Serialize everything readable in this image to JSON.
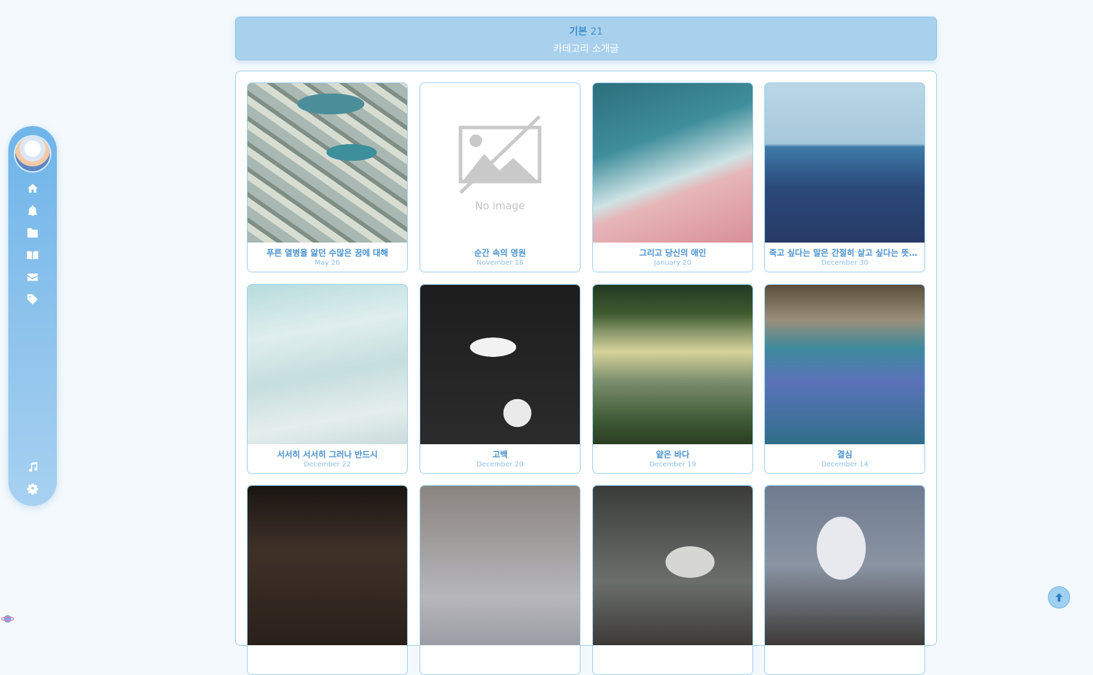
{
  "header": {
    "category_name": "기본",
    "count": "21",
    "description": "카테고리 소개글"
  },
  "sidebar": {
    "items": [
      {
        "icon": "home-icon"
      },
      {
        "icon": "bell-icon"
      },
      {
        "icon": "folder-icon"
      },
      {
        "icon": "book-icon"
      },
      {
        "icon": "envelope-icon"
      },
      {
        "icon": "tag-icon"
      },
      {
        "icon": "music-icon"
      },
      {
        "icon": "gear-icon"
      }
    ]
  },
  "placeholder": {
    "no_image_text": "No image"
  },
  "posts": [
    {
      "title": "푸른 열병을 앓던 수많은 꿈에 대해",
      "date": "May 26"
    },
    {
      "title": "순간 속의 영원",
      "date": "November 16"
    },
    {
      "title": "그리고 당신의 애인",
      "date": "January 20"
    },
    {
      "title": "죽고 싶다는 말은 간절히 살고 싶다는 뜻이…",
      "date": "December 30"
    },
    {
      "title": "서서히 서서히 그러나 반드시",
      "date": "December 22"
    },
    {
      "title": "고백",
      "date": "December 20"
    },
    {
      "title": "얕은 바다",
      "date": "December 19"
    },
    {
      "title": "결심",
      "date": "December 14"
    },
    {
      "title": "",
      "date": ""
    },
    {
      "title": "",
      "date": ""
    },
    {
      "title": "",
      "date": ""
    },
    {
      "title": "",
      "date": ""
    }
  ],
  "colors": {
    "accent": "#4a92cf",
    "header_bg": "#a9d1ee",
    "card_border": "#99cfee"
  }
}
